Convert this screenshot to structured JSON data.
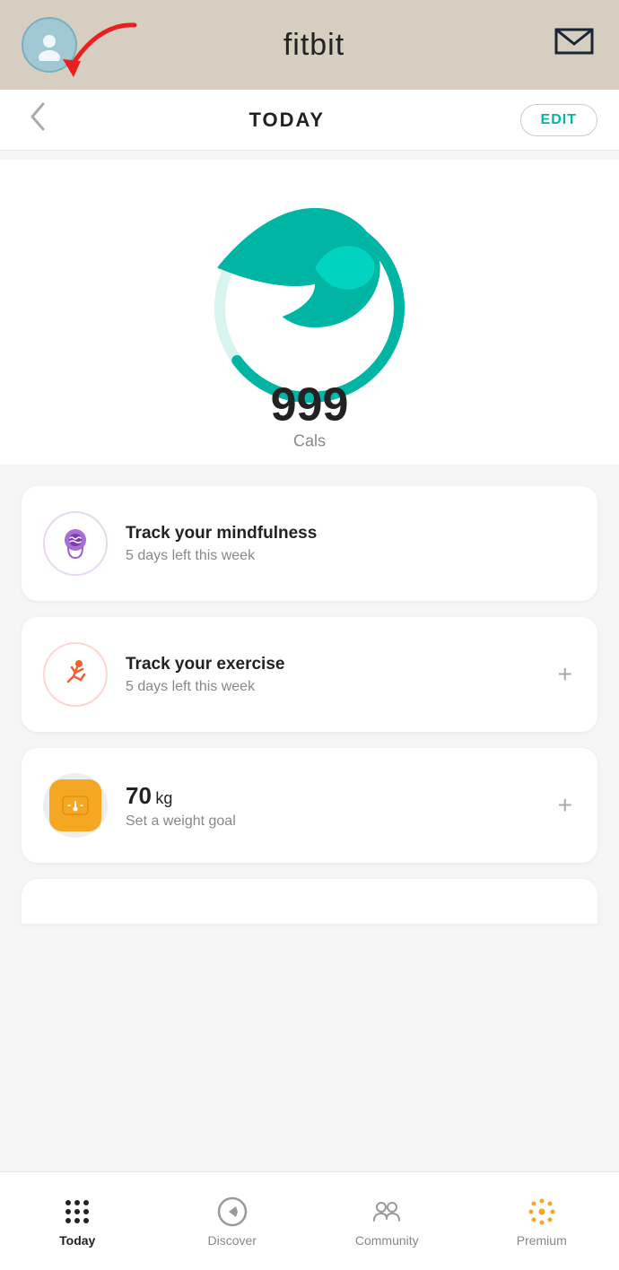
{
  "topbar": {
    "title": "fitbit",
    "avatar_alt": "user-avatar"
  },
  "subheader": {
    "today_label": "TODAY",
    "edit_label": "EDIT"
  },
  "calories": {
    "value": "999",
    "unit": "Cals",
    "progress_pct": 65
  },
  "cards": [
    {
      "id": "mindfulness",
      "title": "Track your mindfulness",
      "subtitle": "5 days left this week",
      "has_action": false
    },
    {
      "id": "exercise",
      "title": "Track your exercise",
      "subtitle": "5 days left this week",
      "has_action": true,
      "action_label": "+"
    },
    {
      "id": "weight",
      "title": "70",
      "title_unit": "kg",
      "subtitle": "Set a weight goal",
      "has_action": true,
      "action_label": "+"
    }
  ],
  "bottom_nav": {
    "items": [
      {
        "id": "today",
        "label": "Today",
        "active": true
      },
      {
        "id": "discover",
        "label": "Discover",
        "active": false
      },
      {
        "id": "community",
        "label": "Community",
        "active": false
      },
      {
        "id": "premium",
        "label": "Premium",
        "active": false
      }
    ]
  }
}
